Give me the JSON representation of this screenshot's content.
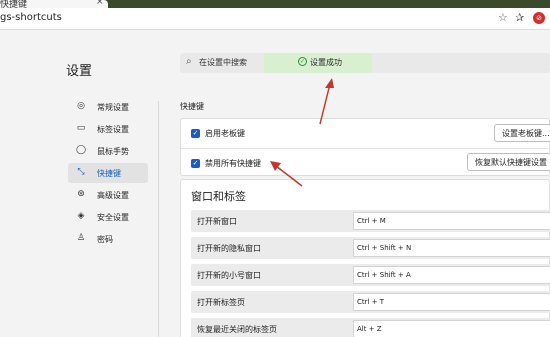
{
  "browser": {
    "tab_title": "快捷键",
    "tab_close": "×",
    "url": "gs-shortcuts",
    "star_icon": "star-icon",
    "favorites_icon": "favorites-icon",
    "extension_icon": "extension-icon"
  },
  "settings": {
    "title": "设置",
    "search_placeholder": "在设置中搜索",
    "toast": "设置成功"
  },
  "sidebar": {
    "items": [
      {
        "label": "常规设置",
        "icon": "general-icon",
        "glyph": "◎"
      },
      {
        "label": "标签设置",
        "icon": "tab-icon",
        "glyph": "▭"
      },
      {
        "label": "鼠标手势",
        "icon": "mouse-icon",
        "glyph": "◯"
      },
      {
        "label": "快捷键",
        "icon": "shortcut-icon",
        "glyph": "⤡"
      },
      {
        "label": "高级设置",
        "icon": "advanced-icon",
        "glyph": "⊛"
      },
      {
        "label": "安全设置",
        "icon": "security-icon",
        "glyph": "◈"
      },
      {
        "label": "密码",
        "icon": "password-icon",
        "glyph": "♙"
      }
    ],
    "active_index": 3
  },
  "shortcuts": {
    "section_title": "快捷键",
    "options": [
      {
        "label": "启用老板键",
        "checked": true,
        "button": "设置老板键..."
      },
      {
        "label": "禁用所有快捷键",
        "checked": true,
        "button": "恢复默认快捷键设置"
      }
    ]
  },
  "window_tabs": {
    "title": "窗口和标签",
    "rows": [
      {
        "name": "打开新窗口",
        "key": "Ctrl + M"
      },
      {
        "name": "打开新的隐私窗口",
        "key": "Ctrl + Shift + N"
      },
      {
        "name": "打开新的小号窗口",
        "key": "Ctrl + Shift + A"
      },
      {
        "name": "打开新标签页",
        "key": "Ctrl + T"
      },
      {
        "name": "恢复最近关闭的标签页",
        "key": "Alt + Z"
      }
    ]
  },
  "colors": {
    "accent": "#1d5bbf",
    "toast_bg": "#d8efd0",
    "arrow": "#c0392b"
  }
}
